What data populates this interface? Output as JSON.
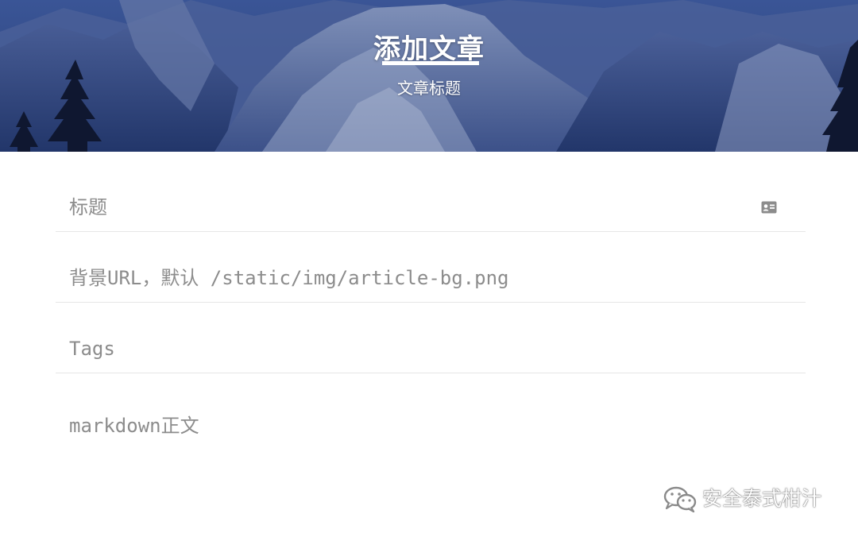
{
  "hero": {
    "title": "添加文章",
    "subtitle": "文章标题"
  },
  "form": {
    "title_field": {
      "placeholder": "标题",
      "icon": "id-card-icon"
    },
    "background_url_field": {
      "placeholder": "背景URL，默认 /static/img/article-bg.png"
    },
    "tags_field": {
      "placeholder": "Tags"
    },
    "body_field": {
      "placeholder": "markdown正文"
    }
  },
  "watermark": {
    "text": "安全泰式柑汁",
    "icon": "wechat-icon"
  },
  "colors": {
    "hero_blue": "#2a3f7a",
    "placeholder_gray": "#8c8c8c",
    "divider_gray": "#e6e6e6",
    "white": "#ffffff"
  }
}
